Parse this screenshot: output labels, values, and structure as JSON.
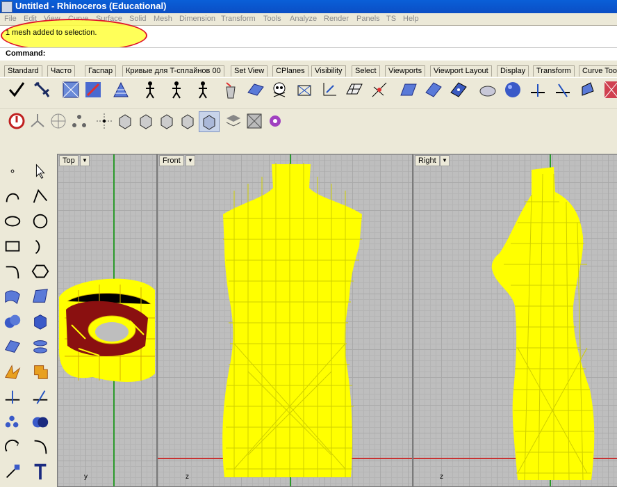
{
  "window": {
    "title": "Untitled - Rhinoceros (Educational)"
  },
  "menu": [
    "File",
    "Edit",
    "View",
    "Curve",
    "Surface",
    "Solid",
    "Mesh",
    "Dimension",
    "Transform",
    "Tools",
    "Analyze",
    "Render",
    "Panels",
    "TS",
    "Help"
  ],
  "history": {
    "message": "1 mesh added to selection."
  },
  "command": {
    "label": "Command:"
  },
  "tabs": [
    "Standard",
    "Часто",
    "Гаспар",
    "Кривые для T-сплайнов 00",
    "Set View",
    "CPlanes",
    "Visibility",
    "Select",
    "Viewports",
    "Viewport Layout",
    "Display",
    "Transform",
    "Curve Tools"
  ],
  "viewports": [
    {
      "title": "Top",
      "axis": "y"
    },
    {
      "title": "Front",
      "axis": "z"
    },
    {
      "title": "Right",
      "axis": "z"
    }
  ],
  "colors": {
    "wireframe": "#ffff00",
    "axis_green": "#2a9a2a",
    "axis_red": "#c83232",
    "highlight": "#ffff3c"
  }
}
